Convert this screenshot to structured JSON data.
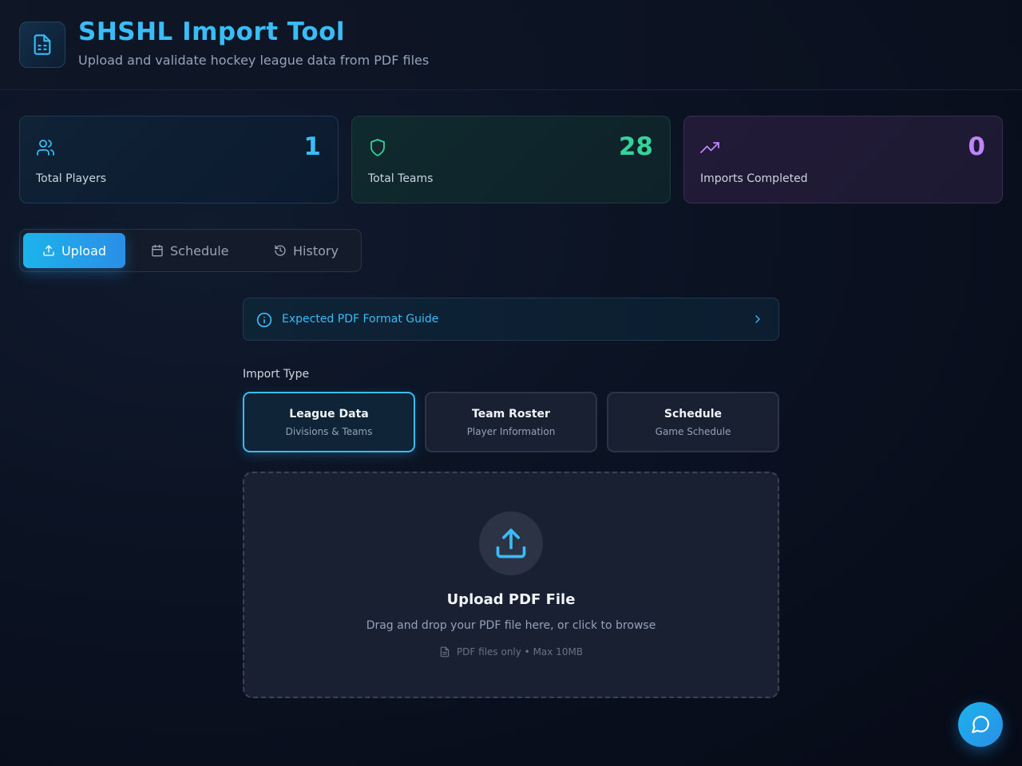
{
  "header": {
    "title": "SHSHL Import Tool",
    "subtitle": "Upload and validate hockey league data from PDF files",
    "logo_icon": "file-spreadsheet-icon"
  },
  "stats": [
    {
      "label": "Total Players",
      "value": "1",
      "icon": "users-icon",
      "color": "#38bdf8"
    },
    {
      "label": "Total Teams",
      "value": "28",
      "icon": "shield-icon",
      "color": "#34d399"
    },
    {
      "label": "Imports Completed",
      "value": "0",
      "icon": "trending-up-icon",
      "color": "#c084fc"
    }
  ],
  "tabs": [
    {
      "label": "Upload",
      "icon": "upload-icon",
      "active": true
    },
    {
      "label": "Schedule",
      "icon": "calendar-icon",
      "active": false
    },
    {
      "label": "History",
      "icon": "history-icon",
      "active": false
    }
  ],
  "guide": {
    "label": "Expected PDF Format Guide",
    "icon": "info-icon",
    "chevron": "chevron-right-icon"
  },
  "import_type": {
    "label": "Import Type",
    "options": [
      {
        "title": "League Data",
        "subtitle": "Divisions & Teams",
        "selected": true
      },
      {
        "title": "Team Roster",
        "subtitle": "Player Information",
        "selected": false
      },
      {
        "title": "Schedule",
        "subtitle": "Game Schedule",
        "selected": false
      }
    ]
  },
  "dropzone": {
    "title": "Upload PDF File",
    "description": "Drag and drop your PDF file here, or click to browse",
    "hint": "PDF files only • Max 10MB",
    "icon": "upload-icon"
  },
  "chat": {
    "icon": "message-circle-icon"
  },
  "colors": {
    "accent": "#38bdf8",
    "teams": "#34d399",
    "imports": "#c084fc"
  }
}
